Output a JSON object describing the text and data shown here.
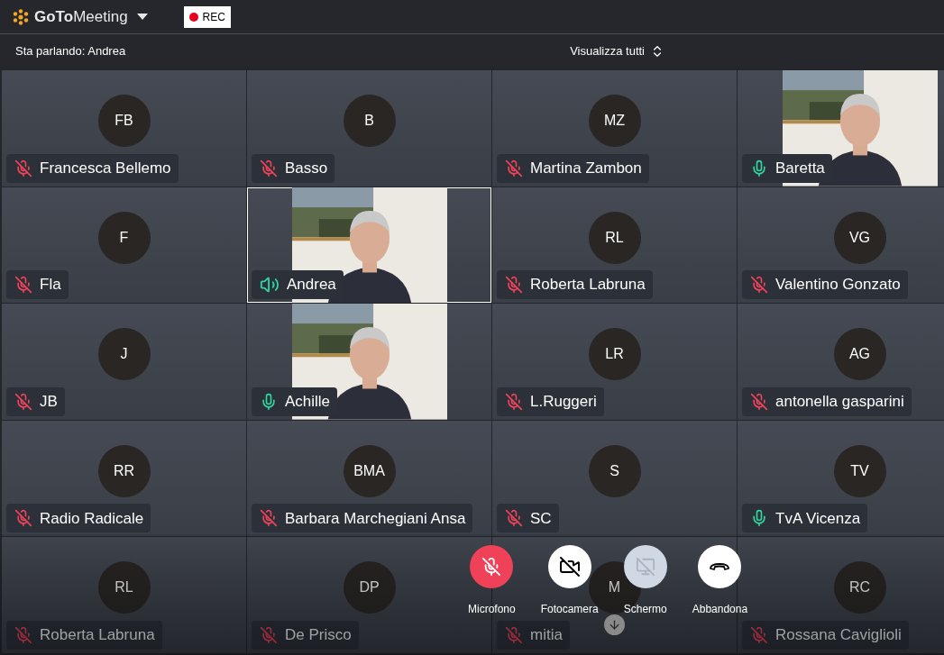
{
  "app": {
    "logo": "**GoTo**Meeting",
    "rec_label": "REC"
  },
  "info_bar": {
    "speaker": "Sta parlando: Andrea",
    "view": "Visualizza tutti"
  },
  "tiles": [
    {
      "kind": "avatar",
      "initials": "FB",
      "name": "Francesca Bellemo",
      "mic_on": false,
      "selected": false
    },
    {
      "kind": "avatar",
      "initials": "B",
      "name": "Basso",
      "mic_on": false,
      "selected": false
    },
    {
      "kind": "avatar",
      "initials": "MZ",
      "name": "Martina Zambon",
      "mic_on": false,
      "selected": false
    },
    {
      "kind": "video",
      "name": "Baretta",
      "mic_on": true,
      "speaking": false,
      "selected": false
    },
    {
      "kind": "avatar",
      "initials": "F",
      "name": "Fla",
      "mic_on": false,
      "selected": false
    },
    {
      "kind": "video",
      "name": "Andrea",
      "mic_on": true,
      "speaking": true,
      "selected": true
    },
    {
      "kind": "avatar",
      "initials": "RL",
      "name": "Roberta Labruna",
      "mic_on": false,
      "selected": false
    },
    {
      "kind": "avatar",
      "initials": "VG",
      "name": "Valentino Gonzato",
      "mic_on": false,
      "selected": false
    },
    {
      "kind": "avatar",
      "initials": "J",
      "name": "JB",
      "mic_on": false,
      "selected": false
    },
    {
      "kind": "video",
      "name": "Achille",
      "mic_on": true,
      "speaking": false,
      "selected": false
    },
    {
      "kind": "avatar",
      "initials": "LR",
      "name": "L.Ruggeri",
      "mic_on": false,
      "selected": false
    },
    {
      "kind": "avatar",
      "initials": "AG",
      "name": "antonella gasparini",
      "mic_on": false,
      "selected": false
    },
    {
      "kind": "avatar",
      "initials": "RR",
      "name": "Radio Radicale",
      "mic_on": false,
      "selected": false
    },
    {
      "kind": "avatar",
      "initials": "BMA",
      "name": "Barbara Marchegiani Ansa",
      "mic_on": false,
      "selected": false
    },
    {
      "kind": "avatar",
      "initials": "S",
      "name": "SC",
      "mic_on": false,
      "selected": false
    },
    {
      "kind": "avatar",
      "initials": "TV",
      "name": "TvA Vicenza",
      "mic_on": true,
      "speaking": false,
      "selected": false
    },
    {
      "kind": "avatar",
      "initials": "RL",
      "name": "Roberta Labruna",
      "mic_on": false,
      "selected": false
    },
    {
      "kind": "avatar",
      "initials": "DP",
      "name": "De Prisco",
      "mic_on": false,
      "selected": false
    },
    {
      "kind": "avatar",
      "initials": "M",
      "name": "mitia",
      "mic_on": false,
      "selected": false
    },
    {
      "kind": "avatar",
      "initials": "RC",
      "name": "Rossana Caviglioli",
      "mic_on": false,
      "selected": false
    }
  ],
  "controls": [
    {
      "kind": "mic",
      "label": "Microfono"
    },
    {
      "kind": "camera",
      "label": "Fotocamera"
    },
    {
      "kind": "screen",
      "label": "Schermo"
    },
    {
      "kind": "leave",
      "label": "Abbandona"
    }
  ]
}
